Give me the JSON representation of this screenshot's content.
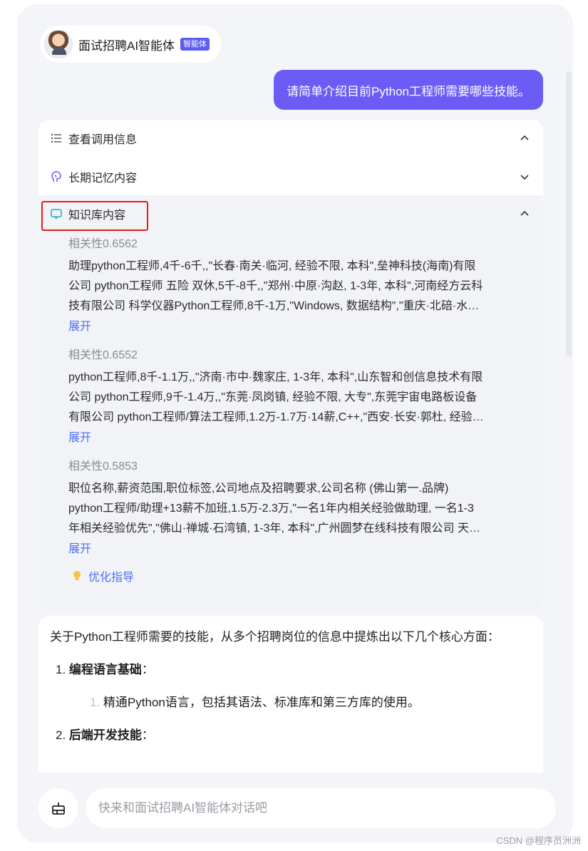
{
  "agent": {
    "name": "面试招聘AI智能体",
    "badge": "智能体"
  },
  "user_message": "请简单介绍目前Python工程师需要哪些技能。",
  "panel": {
    "call_info_label": "查看调用信息",
    "memory_label": "长期记忆内容",
    "knowledge_label": "知识库内容",
    "items": [
      {
        "score": "相关性0.6562",
        "lines": [
          "助理python工程师,4千-6千,,\"长春·南关·临河, 经验不限, 本科\",垒神科技(海南)有限",
          "公司 python工程师 五险 双休,5千-8千,,\"郑州·中原·沟赵, 1-3年, 本科\",河南经方云科",
          "技有限公司 科学仪器Python工程师,8千-1万,\"Windows, 数据结构\",\"重庆·北碚·水…"
        ],
        "expand": "展开"
      },
      {
        "score": "相关性0.6552",
        "lines": [
          "python工程师,8千-1.1万,,\"济南·市中·魏家庄, 1-3年, 本科\",山东智和创信息技术有限",
          "公司 python工程师,9千-1.4万,,\"东莞·凤岗镇, 经验不限, 大专\",东莞宇宙电路板设备",
          "有限公司 python工程师/算法工程师,1.2万-1.7万·14薪,C++,\"西安·长安·郭杜, 经验…"
        ],
        "expand": "展开"
      },
      {
        "score": "相关性0.5853",
        "lines": [
          "职位名称,薪资范围,职位标签,公司地点及招聘要求,公司名称  (佛山第一.品牌)",
          "python工程师/助理+13薪不加班,1.5万-2.3万,\"一名1年内相关经验做助理, 一名1-3",
          "年相关经验优先\",\"佛山·禅城·石湾镇, 1-3年, 本科\",广州圆梦在线科技有限公司 天…"
        ],
        "expand": "展开"
      }
    ],
    "tip_label": "优化指导"
  },
  "answer": {
    "intro": "关于Python工程师需要的技能，从多个招聘岗位的信息中提炼出以下几个核心方面：",
    "point1_num": "1.",
    "point1_title": "编程语言基础",
    "point1_colon": "：",
    "point1_sub_num": "1.",
    "point1_sub": "精通Python语言，包括其语法、标准库和第三方库的使用。",
    "point2_num": "2.",
    "point2_title": "后端开发技能",
    "point2_colon": "："
  },
  "input": {
    "placeholder": "快来和面试招聘AI智能体对话吧"
  },
  "watermark": "CSDN @程序员洲洲",
  "colors": {
    "accent": "#6b5cf6",
    "link": "#4f6ef7",
    "highlight": "#e31d1d"
  }
}
